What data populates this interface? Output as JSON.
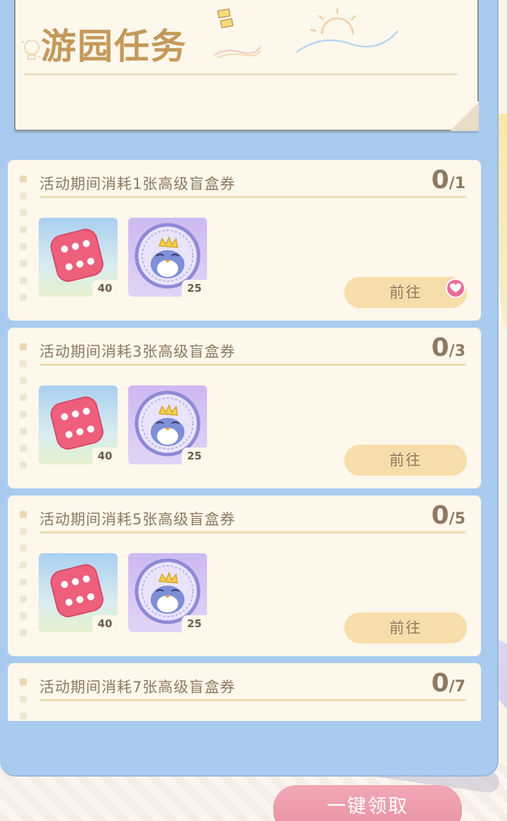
{
  "header": {
    "title": "游园任务"
  },
  "tasks": [
    {
      "title": "活动期间消耗1张高级盲盒券",
      "progress_current": "0",
      "progress_total": "1",
      "rewards": [
        {
          "icon": "dice-icon",
          "count": "40"
        },
        {
          "icon": "penguin-coin-icon",
          "count": "25"
        }
      ],
      "button_label": "前往",
      "has_badge": true
    },
    {
      "title": "活动期间消耗3张高级盲盒券",
      "progress_current": "0",
      "progress_total": "3",
      "rewards": [
        {
          "icon": "dice-icon",
          "count": "40"
        },
        {
          "icon": "penguin-coin-icon",
          "count": "25"
        }
      ],
      "button_label": "前往",
      "has_badge": false
    },
    {
      "title": "活动期间消耗5张高级盲盒券",
      "progress_current": "0",
      "progress_total": "5",
      "rewards": [
        {
          "icon": "dice-icon",
          "count": "40"
        },
        {
          "icon": "penguin-coin-icon",
          "count": "25"
        }
      ],
      "button_label": "前往",
      "has_badge": false
    },
    {
      "title": "活动期间消耗7张高级盲盒券",
      "progress_current": "0",
      "progress_total": "7"
    }
  ],
  "footer": {
    "claim_all_label": "一键领取"
  },
  "colors": {
    "panel_blue": "#a9cbef",
    "card_bg": "#fdf7ec",
    "text_brown": "#8d7a62",
    "title_gold": "#c49a5b",
    "button_yellow": "#f6ddaa",
    "claim_pink": "#e892a3",
    "badge_pink": "#e96b9a"
  }
}
